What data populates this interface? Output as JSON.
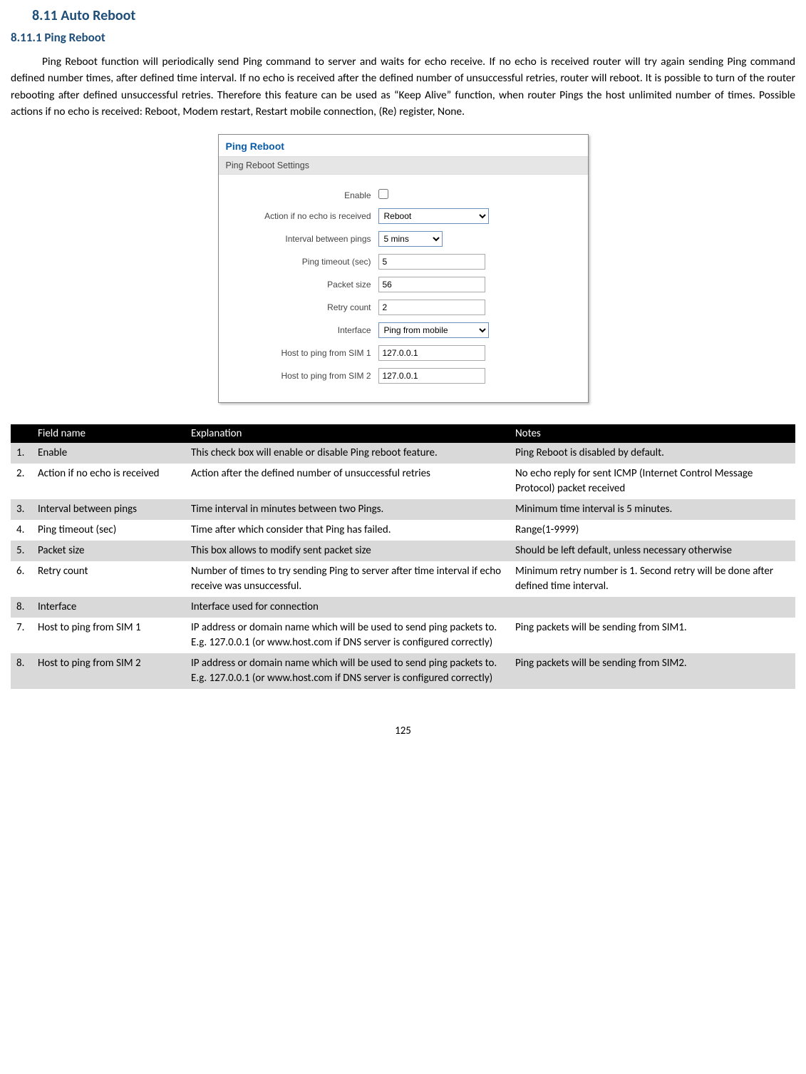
{
  "headings": {
    "h1": "8.11 Auto Reboot",
    "h2": "8.11.1  Ping Reboot"
  },
  "paragraph": "Ping Reboot function will periodically send Ping command to server and waits for echo receive. If no echo is received router will try again sending Ping command defined number times, after defined time interval. If no echo is received after the defined number of unsuccessful retries, router will reboot. It is possible to turn of the router rebooting after defined unsuccessful retries. Therefore this feature can be used as “Keep Alive” function, when router Pings the host unlimited number of times. Possible actions if no echo is received: Reboot, Modem restart, Restart mobile connection, (Re) register, None.",
  "screenshot": {
    "panel_title": "Ping Reboot",
    "panel_subtitle": "Ping Reboot Settings",
    "fields": {
      "enable_label": "Enable",
      "action_label": "Action if no echo is received",
      "action_value": "Reboot",
      "interval_label": "Interval between pings",
      "interval_value": "5 mins",
      "timeout_label": "Ping timeout (sec)",
      "timeout_value": "5",
      "packet_label": "Packet size",
      "packet_value": "56",
      "retry_label": "Retry count",
      "retry_value": "2",
      "iface_label": "Interface",
      "iface_value": "Ping from mobile",
      "host1_label": "Host to ping from SIM 1",
      "host1_value": "127.0.0.1",
      "host2_label": "Host to ping from SIM 2",
      "host2_value": "127.0.0.1"
    }
  },
  "table": {
    "headers": {
      "num": "",
      "name": "Field name",
      "expl": "Explanation",
      "notes": "Notes"
    },
    "rows": [
      {
        "num": "1.",
        "name": "Enable",
        "expl": "This check box will enable or disable Ping reboot feature.",
        "notes": "Ping Reboot is disabled by default."
      },
      {
        "num": "2.",
        "name": "Action if no echo is received",
        "expl": "Action after the defined number of unsuccessful retries",
        "notes": "No echo reply for sent ICMP (Internet Control Message Protocol) packet received"
      },
      {
        "num": "3.",
        "name": "Interval between pings",
        "expl": "Time interval in minutes between two Pings.",
        "notes": "Minimum time interval is 5 minutes."
      },
      {
        "num": "4.",
        "name": "Ping timeout (sec)",
        "expl": "Time after which consider that Ping has failed.",
        "notes": "Range(1-9999)"
      },
      {
        "num": "5.",
        "name": "Packet size",
        "expl": "This box allows to modify sent packet size",
        "notes": "Should be left default, unless necessary otherwise"
      },
      {
        "num": "6.",
        "name": "Retry count",
        "expl": "Number of times to try sending Ping to server after time interval if echo receive was unsuccessful.",
        "notes": "Minimum retry number is 1. Second retry will be done after defined time interval."
      },
      {
        "num": "8.",
        "name": "Interface",
        "expl": "Interface used for connection",
        "notes": ""
      },
      {
        "num": "7.",
        "name": "Host to ping from SIM 1",
        "expl": "IP address or domain name which will be used to send ping packets to. E.g. 127.0.0.1 (or www.host.com if DNS server is configured correctly)",
        "notes": "Ping packets will be sending from SIM1."
      },
      {
        "num": "8.",
        "name": "Host to ping from SIM 2",
        "expl": "IP address or domain name which will be used to send ping packets to. E.g. 127.0.0.1 (or www.host.com if DNS server is configured correctly)",
        "notes": "Ping packets will be sending from SIM2."
      }
    ]
  },
  "page_number": "125"
}
